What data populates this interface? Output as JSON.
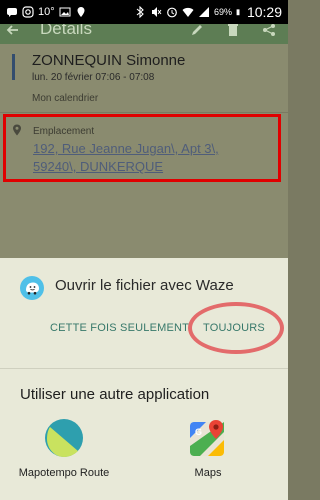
{
  "statusbar": {
    "weather": "10°",
    "battery_percent": "69%",
    "time": "10:29",
    "icons": [
      "chat-icon",
      "instagram-icon",
      "weather-icon",
      "image-icon",
      "location-icon",
      "bluetooth-icon",
      "mute-icon",
      "alarm-icon",
      "wifi-icon",
      "signal-icon",
      "battery-icon"
    ]
  },
  "appbar": {
    "title": "Détails",
    "actions": [
      "edit-icon",
      "delete-icon",
      "share-icon"
    ]
  },
  "event": {
    "title": "ZONNEQUIN Simonne",
    "date": "lun. 20 février 07:06 - 07:08",
    "calendar": "Mon calendrier"
  },
  "location": {
    "label": "Emplacement",
    "line1": "192, Rue Jeanne Jugan\\, Apt 3\\,",
    "line2": "59240\\, DUNKERQUE"
  },
  "chooser": {
    "open_with": "Ouvrir le fichier avec Waze",
    "just_once": "CETTE FOIS SEULEMENT",
    "always": "TOUJOURS",
    "other_app_heading": "Utiliser une autre application",
    "apps": [
      {
        "label": "Mapotempo Route",
        "icon": "mapotempo-icon"
      },
      {
        "label": "Maps",
        "icon": "google-maps-icon"
      }
    ]
  },
  "colors": {
    "appbar": "#5d7d54",
    "button_text": "#37786a",
    "highlight_box": "#e00000",
    "highlight_oval": "#e36b6b"
  }
}
